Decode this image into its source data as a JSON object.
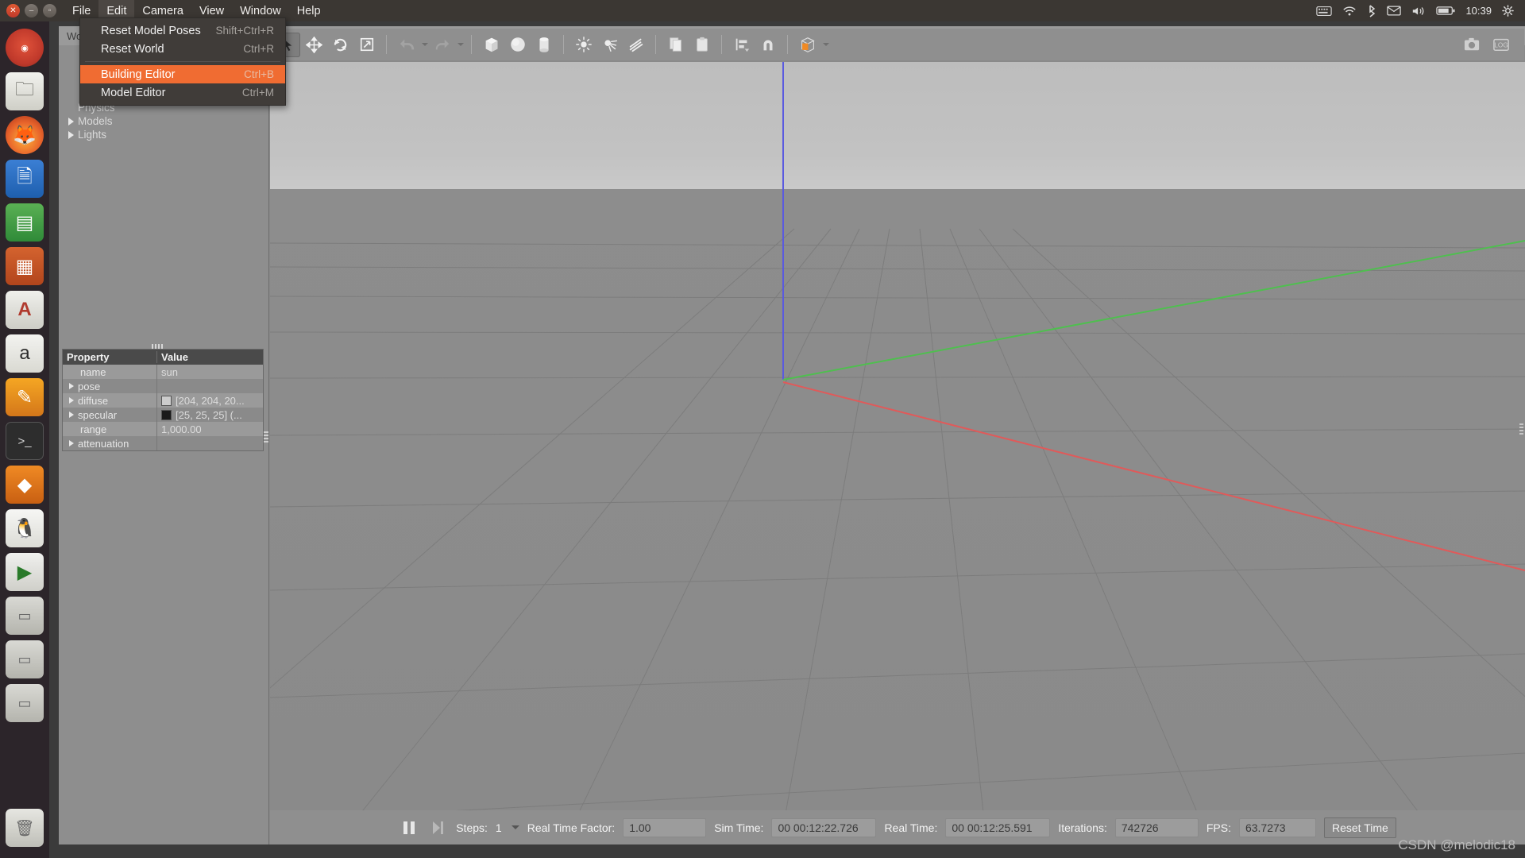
{
  "system_panel": {
    "window_controls": [
      "close",
      "minimize",
      "maximize"
    ],
    "menus": [
      {
        "label": "File",
        "active": false
      },
      {
        "label": "Edit",
        "active": true
      },
      {
        "label": "Camera",
        "active": false
      },
      {
        "label": "View",
        "active": false
      },
      {
        "label": "Window",
        "active": false
      },
      {
        "label": "Help",
        "active": false
      }
    ],
    "tray": {
      "icons": [
        "keyboard-icon",
        "wifi-icon",
        "bluetooth-icon",
        "mail-icon",
        "volume-icon",
        "battery-icon"
      ],
      "clock": "10:39",
      "gear": "gear-icon"
    }
  },
  "edit_menu": {
    "items": [
      {
        "label": "Reset Model Poses",
        "shortcut": "Shift+Ctrl+R",
        "highlighted": false,
        "separator_after": false
      },
      {
        "label": "Reset World",
        "shortcut": "Ctrl+R",
        "highlighted": false,
        "separator_after": true
      },
      {
        "label": "Building Editor",
        "shortcut": "Ctrl+B",
        "highlighted": true,
        "separator_after": false
      },
      {
        "label": "Model Editor",
        "shortcut": "Ctrl+M",
        "highlighted": false,
        "separator_after": false
      }
    ]
  },
  "window": {
    "title": "World"
  },
  "toolbar": {
    "groups": [
      {
        "buttons": [
          {
            "name": "select-mode",
            "icon": "cursor-arrow-icon",
            "selected": true
          },
          {
            "name": "translate-mode",
            "icon": "move-arrows-icon",
            "selected": false
          },
          {
            "name": "rotate-mode",
            "icon": "rotate-icon",
            "selected": false
          },
          {
            "name": "scale-mode",
            "icon": "scale-icon",
            "selected": false
          }
        ]
      },
      {
        "buttons": [
          {
            "name": "undo",
            "icon": "undo-arrow-icon",
            "selected": false
          },
          {
            "name": "undo-history",
            "icon": "chevron-down-icon",
            "selected": false
          },
          {
            "name": "redo",
            "icon": "redo-arrow-icon",
            "selected": false
          },
          {
            "name": "redo-history",
            "icon": "chevron-down-icon",
            "selected": false
          }
        ]
      },
      {
        "buttons": [
          {
            "name": "insert-box",
            "icon": "box-icon",
            "selected": false
          },
          {
            "name": "insert-sphere",
            "icon": "sphere-icon",
            "selected": false
          },
          {
            "name": "insert-cylinder",
            "icon": "cylinder-icon",
            "selected": false
          }
        ]
      },
      {
        "buttons": [
          {
            "name": "insert-point-light",
            "icon": "point-light-icon",
            "selected": false
          },
          {
            "name": "insert-spot-light",
            "icon": "spot-light-icon",
            "selected": false
          },
          {
            "name": "insert-directional-light",
            "icon": "directional-light-icon",
            "selected": false
          }
        ]
      },
      {
        "buttons": [
          {
            "name": "copy",
            "icon": "copy-icon",
            "selected": false
          },
          {
            "name": "paste",
            "icon": "paste-icon",
            "selected": false
          }
        ]
      },
      {
        "buttons": [
          {
            "name": "align",
            "icon": "align-icon",
            "selected": false
          },
          {
            "name": "snap",
            "icon": "magnet-icon",
            "selected": false
          }
        ]
      },
      {
        "buttons": [
          {
            "name": "view-angle",
            "icon": "view-cube-icon",
            "selected": false
          }
        ]
      }
    ],
    "right_buttons": [
      {
        "name": "screenshot",
        "icon": "camera-icon"
      },
      {
        "name": "log-record",
        "icon": "record-icon"
      }
    ]
  },
  "left_panel": {
    "tree": [
      {
        "label": "Physics",
        "expandable": false,
        "indent": 0
      },
      {
        "label": "Models",
        "expandable": true,
        "indent": 0
      },
      {
        "label": "Lights",
        "expandable": true,
        "indent": 0
      }
    ],
    "property_table": {
      "headers": {
        "property": "Property",
        "value": "Value"
      },
      "rows": [
        {
          "name": "name",
          "value": "sun",
          "expandable": false,
          "indented": true,
          "swatch": null
        },
        {
          "name": "pose",
          "value": "",
          "expandable": true,
          "indented": false,
          "swatch": null
        },
        {
          "name": "diffuse",
          "value": "[204, 204, 20...",
          "expandable": true,
          "indented": false,
          "swatch": "#cccccc"
        },
        {
          "name": "specular",
          "value": "[25, 25, 25] (...",
          "expandable": true,
          "indented": false,
          "swatch": "#1a1a1a"
        },
        {
          "name": "range",
          "value": "1,000.00",
          "expandable": false,
          "indented": true,
          "swatch": null
        },
        {
          "name": "attenuation",
          "value": "",
          "expandable": true,
          "indented": false,
          "swatch": null
        }
      ]
    }
  },
  "viewport": {
    "axes": {
      "x_axis_color": "#e05a5a",
      "y_axis_color": "#4fbf4f",
      "z_axis_color": "#5a5ae0"
    },
    "grid_color": "#7c7c7c",
    "sky_color": "#c2c2c2",
    "ground_color": "#8b8b8b"
  },
  "status_bar": {
    "play_pause_icon": "pause-icon",
    "step_icon": "step-forward-icon",
    "steps_label": "Steps:",
    "steps_value": "1",
    "real_time_factor_label": "Real Time Factor:",
    "real_time_factor_value": "1.00",
    "sim_time_label": "Sim Time:",
    "sim_time_value": "00 00:12:22.726",
    "real_time_label": "Real Time:",
    "real_time_value": "00 00:12:25.591",
    "iterations_label": "Iterations:",
    "iterations_value": "742726",
    "fps_label": "FPS:",
    "fps_value": "63.7273",
    "reset_time_label": "Reset Time"
  },
  "launcher": {
    "items": [
      {
        "name": "dash",
        "glyph": "◉"
      },
      {
        "name": "files",
        "glyph": "☰"
      },
      {
        "name": "firefox",
        "glyph": "◕"
      },
      {
        "name": "writer",
        "glyph": "≡"
      },
      {
        "name": "calc",
        "glyph": "⊞"
      },
      {
        "name": "impress",
        "glyph": "▤"
      },
      {
        "name": "fontviewer",
        "glyph": "A"
      },
      {
        "name": "amazon",
        "glyph": "a"
      },
      {
        "name": "software",
        "glyph": "✎"
      },
      {
        "name": "terminal",
        "glyph": ">_"
      },
      {
        "name": "gazebo",
        "glyph": "◆"
      },
      {
        "name": "qq",
        "glyph": "❀"
      },
      {
        "name": "player",
        "glyph": "▶"
      },
      {
        "name": "disk1",
        "glyph": "▭"
      },
      {
        "name": "disk2",
        "glyph": "▭"
      },
      {
        "name": "disk3",
        "glyph": "▭"
      },
      {
        "name": "trash",
        "glyph": "□"
      }
    ]
  },
  "watermark": {
    "text": "CSDN @melodic18"
  }
}
